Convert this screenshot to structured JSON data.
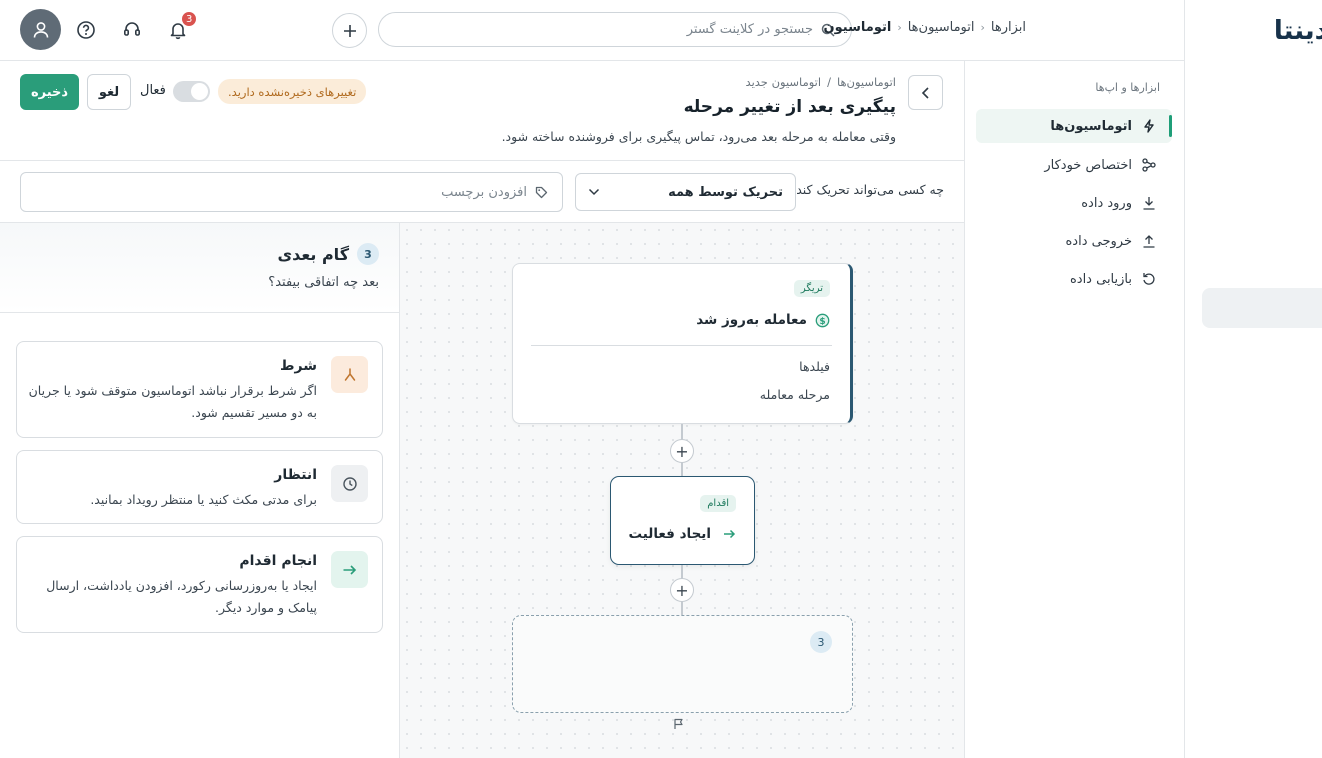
{
  "brand": {
    "name": "دینتا"
  },
  "topbar": {
    "search_placeholder": "جستجو در کلاینت گستر",
    "notification_count": "3",
    "breadcrumb": [
      "ابزارها",
      "اتوماسیون‌ها",
      "اتوماسیون"
    ]
  },
  "sidebar": {
    "title": "ابزارها و اپ‌ها",
    "items": [
      {
        "label": "اتوماسیون‌ها",
        "icon": "bolt-icon",
        "active": true
      },
      {
        "label": "اختصاص خودکار",
        "icon": "share-nodes-icon",
        "active": false
      },
      {
        "label": "ورود داده",
        "icon": "download-icon",
        "active": false
      },
      {
        "label": "خروجی داده",
        "icon": "upload-icon",
        "active": false
      },
      {
        "label": "بازیابی داده",
        "icon": "restore-icon",
        "active": false
      }
    ]
  },
  "page_header": {
    "breadcrumb": [
      "اتوماسیون‌ها",
      "/",
      "اتوماسیون جدید"
    ],
    "title": "پیگیری بعد از تغییر مرحله",
    "description": "وقتی معامله به مرحله بعد می‌رود، تماس پیگیری برای فروشنده ساخته شود.",
    "unsaved_text": "تغییرهای ذخیره‌نشده دارید.",
    "active_label": "فعال",
    "active_on": false,
    "cancel_label": "لغو",
    "save_label": "ذخیره",
    "accent_color": "#2a9d7a"
  },
  "filters": {
    "trigger_who_label": "چه کسی می‌تواند تحریک کند",
    "trigger_who_value": "تحریک توسط همه",
    "tag_placeholder": "افزودن برچسب"
  },
  "canvas": {
    "trigger": {
      "chip": "تریگر",
      "title": "معامله به‌روز شد",
      "line1": "فیلدها",
      "line2": "مرحله معامله"
    },
    "action": {
      "chip": "اقدام",
      "title": "ایجاد فعالیت"
    },
    "next_step_number": "3"
  },
  "panel": {
    "step_number": "3",
    "title": "گام بعدی",
    "subtitle": "بعد چه اتفاقی بیفتد؟",
    "options": [
      {
        "title": "شرط",
        "desc": "اگر شرط برقرار نباشد اتوماسیون متوقف شود یا جریان به دو مسیر تقسیم شود.",
        "icon": "split-icon",
        "color": "#fcebdd"
      },
      {
        "title": "انتظار",
        "desc": "برای مدتی مکث کنید یا منتظر رویداد بمانید.",
        "icon": "clock-icon",
        "color": "#eef0f2"
      },
      {
        "title": "انجام اقدام",
        "desc": "ایجاد یا به‌روزرسانی رکورد، افزودن یادداشت، ارسال پیامک و موارد دیگر.",
        "icon": "arrow-right-icon",
        "color": "#e3f4ee"
      }
    ]
  }
}
